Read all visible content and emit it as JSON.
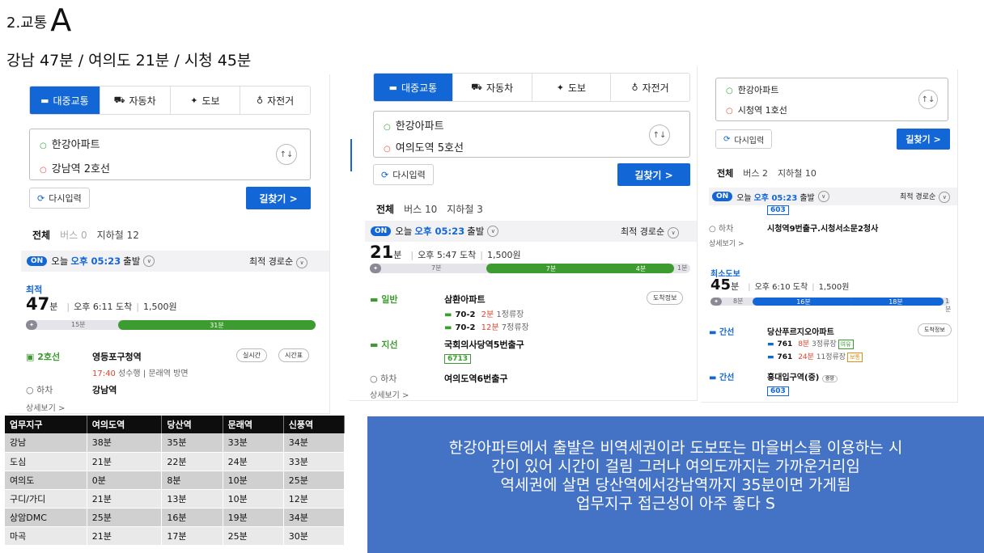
{
  "title": {
    "text": "2.교통",
    "letter": "A"
  },
  "subtitle": "강남 47분 / 여의도 21분 / 시청 45분",
  "p1": {
    "modes": [
      {
        "icon": "bus-icon",
        "label": "대중교통"
      },
      {
        "icon": "car-icon",
        "label": "자동차"
      },
      {
        "icon": "walk-icon",
        "label": "도보"
      },
      {
        "icon": "bicycle-icon",
        "label": "자전거"
      }
    ],
    "start": "한강아파트",
    "end": "강남역 2호선",
    "reset": "다시입력",
    "go": "길찾기 >",
    "tabs": {
      "all": "전체",
      "bus": "버스 0",
      "subway": "지하철 12"
    },
    "timebar": {
      "on": "ON",
      "day": "오늘",
      "time": "오후 05:23",
      "depart": "출발",
      "sort": "최적 경로순"
    },
    "best": "최적",
    "duration": {
      "num": "47",
      "unit": "분",
      "arrive": "오후 6:11 도착",
      "fare": "1,500원"
    },
    "bar": {
      "walk": "15분",
      "ride": "31분"
    },
    "line": "2호선",
    "station": "영등포구청역",
    "btn_realtime": "실시간",
    "btn_timetable": "시간표",
    "train_time": "17:40",
    "train_info": "성수행 | 문래역 방면",
    "getoff": "하차",
    "getoff_station": "강남역",
    "more": "상세보기 >"
  },
  "p2": {
    "modes": [
      {
        "icon": "bus-icon",
        "label": "대중교통"
      },
      {
        "icon": "car-icon",
        "label": "자동차"
      },
      {
        "icon": "walk-icon",
        "label": "도보"
      },
      {
        "icon": "bicycle-icon",
        "label": "자전거"
      }
    ],
    "start": "한강아파트",
    "end": "여의도역 5호선",
    "reset": "다시입력",
    "go": "길찾기 >",
    "tabs": {
      "all": "전체",
      "bus": "버스 10",
      "subway": "지하철 3"
    },
    "timebar": {
      "on": "ON",
      "day": "오늘",
      "time": "오후 05:23",
      "depart": "출발",
      "sort": "최적 경로순"
    },
    "duration": {
      "num": "21",
      "unit": "분",
      "arrive": "오후 5:47 도착",
      "fare": "1,500원"
    },
    "bar": {
      "walk1": "7분",
      "ride1": "7분",
      "ride2": "4분",
      "walk2": "1분"
    },
    "stop1": {
      "type": "일반",
      "name": "삼환아파트",
      "btn": "도착정보",
      "bus1": {
        "no": "70-2",
        "min": "2분",
        "info": "1정류장"
      },
      "bus2": {
        "no": "70-2",
        "min": "12분",
        "info": "7정류장"
      }
    },
    "stop2": {
      "type": "지선",
      "name": "국회의사당역5번출구",
      "bus": "6713"
    },
    "getoff": "하차",
    "getoff_station": "여의도역6번출구",
    "more": "상세보기 >"
  },
  "p3": {
    "start": "한강아파트",
    "end": "시청역 1호선",
    "reset": "다시입력",
    "go": "길찾기 >",
    "tabs": {
      "all": "전체",
      "bus": "버스 2",
      "subway": "지하철 10"
    },
    "timebar": {
      "on": "ON",
      "day": "오늘",
      "time": "오후 05:23",
      "depart": "출발",
      "sort": "최적 경로순"
    },
    "bus_prev": "603",
    "getoff": "하차",
    "getoff_station": "시청역9번출구.시청서소문2청사",
    "more": "상세보기 >",
    "best": "최소도보",
    "duration": {
      "num": "45",
      "unit": "분",
      "arrive": "오후 6:10 도착",
      "fare": "1,500원"
    },
    "bar": {
      "walk1": "8분",
      "ride1": "16분",
      "ride2": "18분",
      "walk2": "1분"
    },
    "stop1": {
      "type": "간선",
      "name": "당산푸르지오아파트",
      "btn": "도착정보",
      "bus1": {
        "no": "761",
        "min": "8분",
        "info": "3정류장",
        "crowd": "여유"
      },
      "bus2": {
        "no": "761",
        "min": "24분",
        "info": "11정류장",
        "crowd": "보통"
      }
    },
    "stop2": {
      "type": "간선",
      "name": "홍대입구역(중)",
      "tag": "중앙",
      "bus": "603"
    }
  },
  "table": {
    "headers": [
      "업무지구",
      "여의도역",
      "당산역",
      "문래역",
      "신풍역"
    ],
    "rows": [
      [
        "강남",
        "38분",
        "35분",
        "33분",
        "34분"
      ],
      [
        "도심",
        "21분",
        "22분",
        "24분",
        "33분"
      ],
      [
        "여의도",
        "0분",
        "8분",
        "10분",
        "25분"
      ],
      [
        "구디/가디",
        "21분",
        "13분",
        "10분",
        "12분"
      ],
      [
        "상암DMC",
        "25분",
        "16분",
        "19분",
        "34분"
      ],
      [
        "마곡",
        "21분",
        "17분",
        "25분",
        "30분"
      ]
    ]
  },
  "note": {
    "lines": [
      "한강아파트에서 출발은 비역세권이라 도보또는 마을버스를 이용하는 시",
      "간이 있어 시간이 걸림 그러나 여의도까지는 가까운거리임",
      "역세권에 살면 당산역에서강남역까지 35분이면 가게됨",
      "업무지구 접근성이 아주 좋다 S"
    ]
  },
  "colors": {
    "accent": "#1266d6",
    "subway_green": "#3c9c2f",
    "note_bg": "#4472c4",
    "header_bg": "#0d0d0d"
  }
}
